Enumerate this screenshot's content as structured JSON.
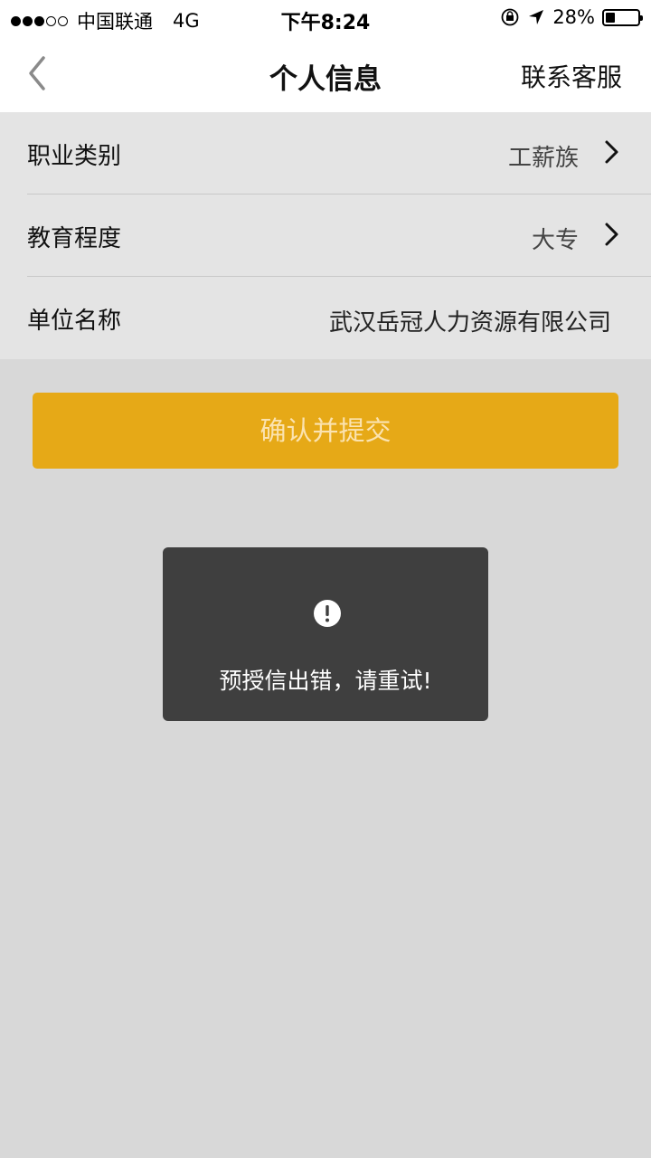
{
  "status_bar": {
    "carrier": "中国联通",
    "network": "4G",
    "time": "下午8:24",
    "battery": "28%",
    "battery_level": 0.28,
    "signal_bars": 3
  },
  "nav": {
    "back_icon": "chevron-left-icon",
    "title": "个人信息",
    "right_label": "联系客服"
  },
  "form": {
    "rows": [
      {
        "label": "职业类别",
        "value": "工薪族"
      },
      {
        "label": "教育程度",
        "value": "大专"
      },
      {
        "label": "单位名称",
        "value": "武汉岳冠人力资源有限公司"
      }
    ]
  },
  "submit": {
    "label": "确认并提交"
  },
  "toast": {
    "icon": "exclamation-icon",
    "message": "预授信出错，请重试!"
  },
  "colors": {
    "accent": "#e6a917",
    "background": "#d8d8d8",
    "toast_bg": "#3f3f3f"
  }
}
